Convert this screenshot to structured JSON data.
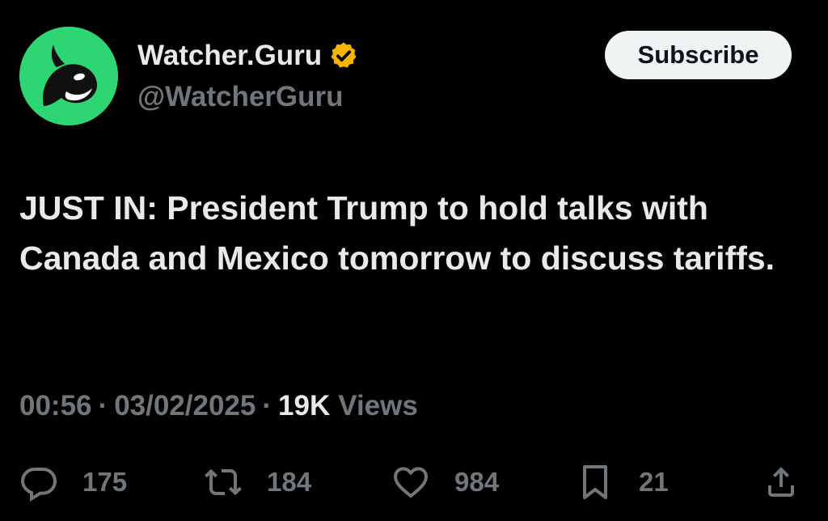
{
  "author": {
    "display_name": "Watcher.Guru",
    "handle": "@WatcherGuru",
    "verified": true,
    "avatar_icon": "orca-whale-logo",
    "avatar_color": "#2ed573",
    "badge_color": "#f5b400"
  },
  "subscribe_button": {
    "label": "Subscribe"
  },
  "tweet": {
    "text": "JUST IN: President Trump to hold talks with Canada and Mexico tomorrow to discuss tariffs."
  },
  "meta": {
    "time": "00:56",
    "separator": "·",
    "date": "03/02/2025",
    "views_count": "19K",
    "views_label": "Views"
  },
  "actions": {
    "reply": {
      "icon": "reply-icon",
      "count": "175"
    },
    "repost": {
      "icon": "repost-icon",
      "count": "184"
    },
    "like": {
      "icon": "heart-icon",
      "count": "984"
    },
    "bookmark": {
      "icon": "bookmark-icon",
      "count": "21"
    },
    "share": {
      "icon": "share-icon"
    }
  },
  "colors": {
    "background": "#000000",
    "primary_text": "#e7e9ea",
    "secondary_text": "#71767b",
    "button_bg": "#eff3f4"
  }
}
